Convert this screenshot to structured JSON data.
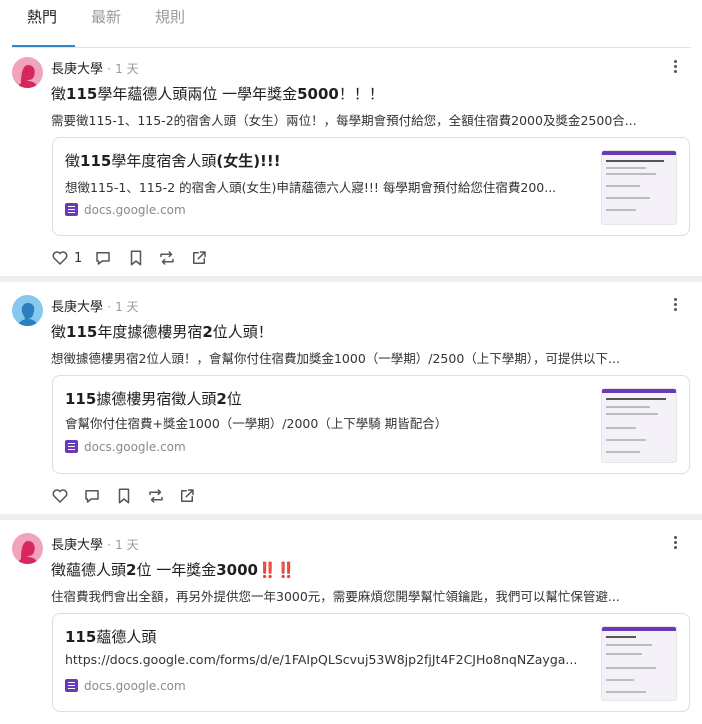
{
  "tabs": [
    "熱門",
    "最新",
    "規則"
  ],
  "icons": {
    "like": "heart-icon",
    "comment": "comment-icon",
    "bookmark": "bookmark-icon",
    "repost": "repost-icon",
    "share": "share-icon",
    "more": "more-vertical-icon",
    "form": "google-forms-icon"
  },
  "colors": {
    "accent": "#2f86c8",
    "forms": "#673ab7",
    "female_avatar": "#f0a3ba",
    "male_avatar": "#86c9ee"
  },
  "posts": [
    {
      "author": "長庚大學",
      "dot": "·",
      "time": "1 天",
      "avatar": "female",
      "title": {
        "pre": "徵",
        "b1": "115",
        "mid": "學年蘊德人頭兩位 一學年獎金",
        "b2": "5000",
        "post": "！！！"
      },
      "excerpt": "需要徵115-1、115-2的宿舍人頭（女生）兩位！，每學期會預付給您，全額住宿費2000及獎金2500合...",
      "card": {
        "title": {
          "pre": "徵",
          "b1": "115",
          "mid": "學年度宿舍人頭",
          "b2": "(女生)!!!"
        },
        "desc": "想徵115-1、115-2 的宿舍人頭(女生)申請蘊德六人寢!!! 每學期會預付給您住宿費200...",
        "source": "docs.google.com"
      },
      "likes": "1"
    },
    {
      "author": "長庚大學",
      "dot": "·",
      "time": "1 天",
      "avatar": "male",
      "title": {
        "pre": "徵",
        "b1": "115",
        "mid": "年度據德樓男宿",
        "b2": "2",
        "post": "位人頭！"
      },
      "excerpt": "想徵據德樓男宿2位人頭！，會幫你付住宿費加獎金1000（一學期）/2500（上下學期），可提供以下...",
      "card": {
        "title": {
          "pre": "",
          "b1": "115",
          "mid": "據德樓男宿徵人頭",
          "b2": "2",
          "post": "位"
        },
        "desc": "會幫你付住宿費+獎金1000（一學期）/2000（上下學騎 期皆配合）",
        "source": "docs.google.com"
      },
      "likes": ""
    },
    {
      "author": "長庚大學",
      "dot": "·",
      "time": "1 天",
      "avatar": "female",
      "title": {
        "pre": "徵蘊德人頭",
        "b1": "2",
        "mid": "位 一年獎金",
        "b2": "3000",
        "post": "‼️‼️"
      },
      "excerpt": "住宿費我們會出全額，再另外提供您一年3000元，需要麻煩您開學幫忙領鑰匙，我們可以幫忙保管避...",
      "card": {
        "title": {
          "pre": "",
          "b1": "115",
          "mid": "蘊德人頭",
          "b2": "",
          "post": ""
        },
        "desc": "https://docs.google.com/forms/d/e/1FAIpQLScvuj53W8jp2fjJt4F2CJHo8nqNZayga...",
        "source": "docs.google.com"
      },
      "likes": ""
    }
  ]
}
